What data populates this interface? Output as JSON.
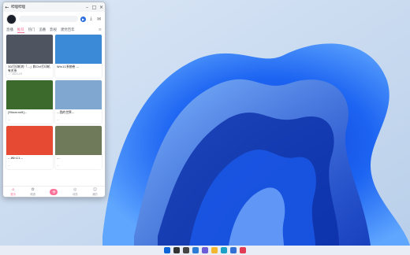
{
  "window": {
    "title": "哔哩哔哩"
  },
  "tabs": [
    "直播",
    "推荐",
    "热门",
    "追番",
    "影视",
    "建党百年"
  ],
  "active_tab": "推荐",
  "cards": [
    {
      "title": "3D打印机的「...」和Ctrl打印机有关系",
      "meta": "...· 2021-07",
      "stat": "",
      "thumb": "#4e5560"
    },
    {
      "title": "Win11系统卷 ...",
      "meta": "",
      "stat": "",
      "thumb": "#3a8ad8"
    },
    {
      "title": "[Minecraft]...",
      "meta": "...",
      "stat": "",
      "thumb": "#3b6a2c"
    },
    {
      "title": "...我的世界...",
      "meta": "...",
      "stat": "",
      "thumb": "#7fa7cf"
    },
    {
      "title": "...Win11...",
      "meta": "...",
      "stat": "",
      "thumb": "#e64a32"
    },
    {
      "title": "...",
      "meta": "...",
      "stat": "",
      "thumb": "#6f7a5a"
    }
  ],
  "nav": [
    "首页",
    "频道",
    "",
    "动态",
    "我的"
  ],
  "taskbar": [
    "windows",
    "search",
    "taskview",
    "widgets",
    "chat",
    "explorer",
    "edge",
    "store",
    "app"
  ]
}
